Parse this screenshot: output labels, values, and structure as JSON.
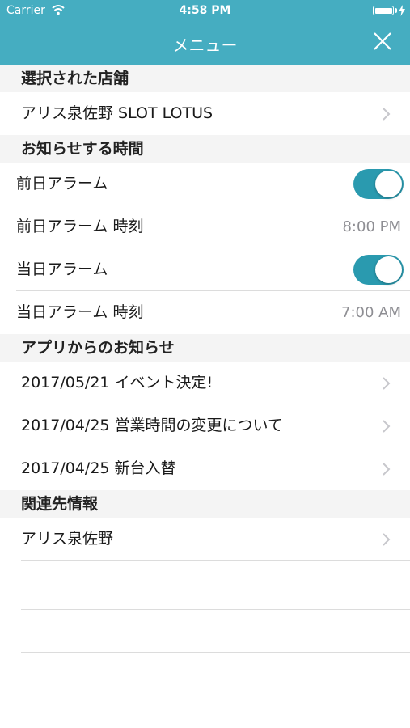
{
  "status_bar": {
    "carrier": "Carrier",
    "time": "4:58 PM"
  },
  "nav": {
    "title": "メニュー"
  },
  "sections": {
    "store": {
      "header": "選択された店舗",
      "items": [
        {
          "label": "アリス泉佐野 SLOT LOTUS"
        }
      ]
    },
    "notify": {
      "header": "お知らせする時間",
      "prev_alarm": {
        "label": "前日アラーム",
        "on": true
      },
      "prev_time": {
        "label": "前日アラーム 時刻",
        "value": "8:00 PM"
      },
      "day_alarm": {
        "label": "当日アラーム",
        "on": true
      },
      "day_time": {
        "label": "当日アラーム 時刻",
        "value": "7:00 AM"
      }
    },
    "news": {
      "header": "アプリからのお知らせ",
      "items": [
        {
          "label": "2017/05/21 イベント決定!"
        },
        {
          "label": "2017/04/25 営業時間の変更について"
        },
        {
          "label": "2017/04/25 新台入替"
        }
      ]
    },
    "related": {
      "header": "関連先情報",
      "items": [
        {
          "label": "アリス泉佐野"
        }
      ]
    }
  },
  "colors": {
    "header_bg": "#45adc1",
    "toggle_on": "#2a9aaf"
  }
}
